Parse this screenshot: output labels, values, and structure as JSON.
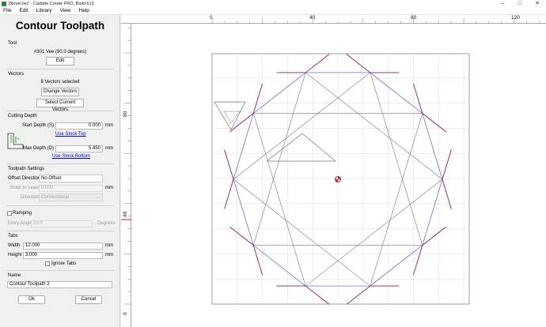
{
  "window": {
    "title": "[Novel.liej* - Carbide Create PRO, Build 613",
    "controls": [
      "–",
      "□",
      "✕"
    ]
  },
  "menu": [
    "File",
    "Edit",
    "Library",
    "View",
    "Help"
  ],
  "panel": {
    "title": "Contour Toolpath",
    "tool": {
      "label": "Tool",
      "name": "#301 Vee (90.0 degrees)",
      "edit_label": "Edit"
    },
    "vectors": {
      "label": "Vectors",
      "count_text": "8 Vectors selected",
      "change_label": "Change Vectors",
      "select_label": "Select Current Vectors"
    },
    "cutting_depth": {
      "label": "Cutting Depth",
      "start_label": "Start Depth (S)",
      "start_value": "0.000",
      "start_unit": "mm",
      "use_stock_top": "Use Stock Top",
      "max_label": "Max Depth (D)",
      "max_value": "5.450",
      "max_unit": "mm",
      "use_stock_bottom": "Use Stock Bottom"
    },
    "settings": {
      "label": "Toolpath Settings",
      "offset_label": "Offset Direction",
      "offset_value": "No Offset",
      "stock_label": "Stock to Leave",
      "stock_value": "0.000",
      "stock_unit": "mm",
      "direction_label": "Direction",
      "direction_value": "Conventional"
    },
    "ramping": {
      "label": "Ramping",
      "checked": false,
      "angle_label": "Entry Angle",
      "angle_value": "20.0",
      "angle_unit": "Degrees"
    },
    "tabs": {
      "label": "Tabs",
      "width_label": "Width",
      "width_value": "12.000",
      "width_unit": "mm",
      "height_label": "Height",
      "height_value": "3.000",
      "height_unit": "mm",
      "ignore_label": "Ignore Tabs",
      "ignore_checked": false
    },
    "name": {
      "label": "Name",
      "value": "Contour Toolpath 2"
    },
    "ok_label": "Ok",
    "cancel_label": "Cancel"
  },
  "canvas": {
    "top_ticks": [
      "0",
      "40",
      "80",
      "120"
    ],
    "left_ticks": [
      "80",
      "40",
      "0"
    ],
    "colors": {
      "selected_vector": "#5555dd",
      "toolpath": "#8b1a6b",
      "vector": "#777777",
      "grid": "#dddddd",
      "stock_border": "#888888",
      "origin_marker": "#d42020"
    },
    "origin_marker_icon": "origin-target-icon"
  }
}
